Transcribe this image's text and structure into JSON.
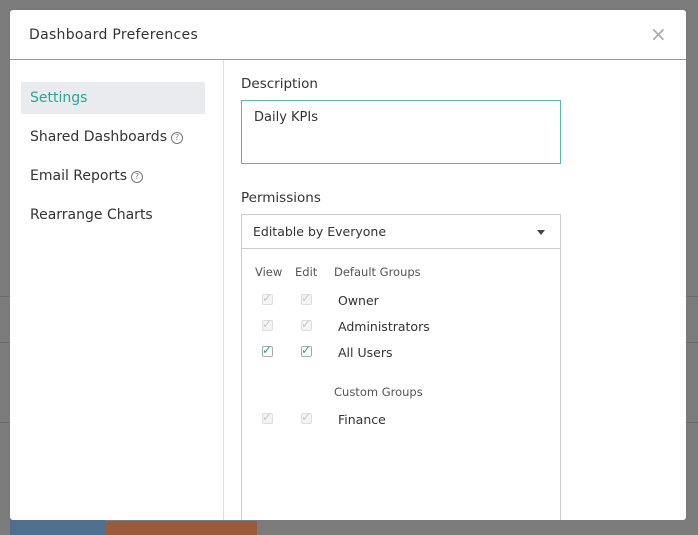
{
  "modal": {
    "title": "Dashboard Preferences",
    "close_label": "×"
  },
  "sidebar": {
    "items": [
      {
        "label": "Settings",
        "active": true,
        "help": false
      },
      {
        "label": "Shared Dashboards",
        "active": false,
        "help": true
      },
      {
        "label": "Email Reports",
        "active": false,
        "help": true
      },
      {
        "label": "Rearrange Charts",
        "active": false,
        "help": false
      }
    ],
    "help_glyph": "?"
  },
  "description": {
    "label": "Description",
    "value": "Daily KPIs"
  },
  "permissions": {
    "label": "Permissions",
    "selected": "Editable by Everyone",
    "columns": {
      "view": "View",
      "edit": "Edit"
    },
    "default_groups": {
      "heading": "Default Groups",
      "rows": [
        {
          "name": "Owner",
          "view": true,
          "edit": true,
          "disabled": true
        },
        {
          "name": "Administrators",
          "view": true,
          "edit": true,
          "disabled": true
        },
        {
          "name": "All Users",
          "view": true,
          "edit": true,
          "disabled": false
        }
      ]
    },
    "custom_groups": {
      "heading": "Custom Groups",
      "rows": [
        {
          "name": "Finance",
          "view": true,
          "edit": true,
          "disabled": true
        }
      ]
    }
  },
  "colors": {
    "accent": "#2aa593",
    "border_accent": "#5bb9ac"
  },
  "icons": {
    "close": "close-icon",
    "help": "help-circle-icon",
    "dropdown": "chevron-down-icon",
    "check": "checkmark-icon"
  }
}
